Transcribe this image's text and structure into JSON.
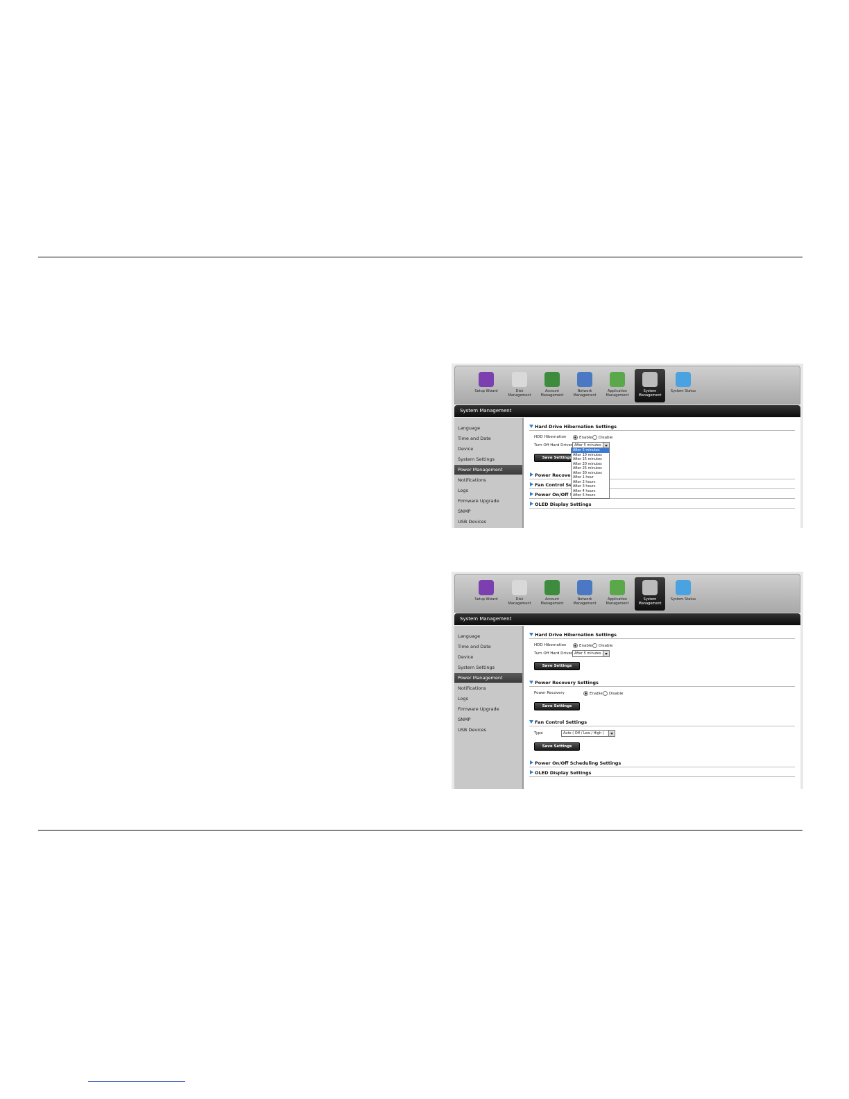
{
  "nav": [
    {
      "label": "Setup Wizard",
      "icon": "wizard-icon",
      "color": "#7b3fb0"
    },
    {
      "label": "Disk Management",
      "icon": "disk-icon",
      "color": "#d9d9d9"
    },
    {
      "label": "Account Management",
      "icon": "account-icon",
      "color": "#3d8c3d"
    },
    {
      "label": "Network Management",
      "icon": "network-icon",
      "color": "#4a78c2"
    },
    {
      "label": "Application Management",
      "icon": "application-icon",
      "color": "#5aa84a"
    },
    {
      "label": "System Management",
      "icon": "gear-icon",
      "color": "#bbbbbb",
      "active": true
    },
    {
      "label": "System Status",
      "icon": "info-icon",
      "color": "#4aa3e0"
    }
  ],
  "section_title": "System Management",
  "sidebar": [
    "Language",
    "Time and Date",
    "Device",
    "System Settings",
    "Power Management",
    "Notifications",
    "Logs",
    "Firmware Upgrade",
    "SNMP",
    "USB Devices"
  ],
  "sidebar_active": "Power Management",
  "shot1": {
    "hibernation_title": "Hard Drive Hibernation Settings",
    "hdd_hibernation_label": "HDD Hibernation",
    "enable_label": "Enable",
    "disable_label": "Disable",
    "turn_off_label": "Turn Off Hard Drives",
    "turn_off_value": "After 5 minutes",
    "save_label": "Save Settings",
    "power_recovery_title": "Power Recovery S",
    "fan_control_title": "Fan Control Settin",
    "power_onoff_title": "Power On/Off Sch",
    "oled_title": "OLED Display Settings",
    "dropdown_options": [
      "After 5 minutes",
      "After 10 minutes",
      "After 15 minutes",
      "After 20 minutes",
      "After 25 minutes",
      "After 30 minutes",
      "After 1 hour",
      "After 2 hours",
      "After 3 hours",
      "After 4 hours",
      "After 5 hours"
    ]
  },
  "shot2": {
    "hibernation_title": "Hard Drive Hibernation Settings",
    "hdd_hibernation_label": "HDD Hibernation",
    "enable_label": "Enable",
    "disable_label": "Disable",
    "turn_off_label": "Turn Off Hard Drives",
    "turn_off_value": "After 5 minutes",
    "save_label": "Save Settings",
    "power_recovery_title": "Power Recovery Settings",
    "power_recovery_label": "Power Recovery",
    "fan_control_title": "Fan Control Settings",
    "fan_type_label": "Type",
    "fan_type_value": "Auto ( Off / Low / High )",
    "power_onoff_title": "Power On/Off Scheduling Settings",
    "oled_title": "OLED Display Settings"
  }
}
